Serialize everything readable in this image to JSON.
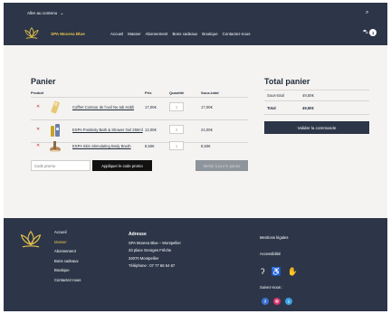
{
  "header": {
    "skip_link": "Aller au contenu",
    "brand": "SPA Moorea Blue",
    "nav": [
      "Accueil",
      "Masser",
      "Abonnement",
      "Bons cadeaux",
      "Boutique",
      "Contactez-nous"
    ],
    "cart_count": "1"
  },
  "cart": {
    "title": "Panier",
    "columns": [
      "Produit",
      "Prix",
      "Quantité",
      "Sous-total"
    ],
    "items": [
      {
        "name": "Coffret Contour de l'oeil Nu tab Hobli",
        "price": "17,00€",
        "qty": "1",
        "subtotal": "17,00€"
      },
      {
        "name": "ESPA Positivity Bath & Shower Gel 250ml",
        "price": "12,00€",
        "qty": "2",
        "subtotal": "24,00€"
      },
      {
        "name": "ESPA Skin Stimulating Body Brush",
        "price": "8,50€",
        "qty": "1",
        "subtotal": "8,50€"
      }
    ],
    "coupon_placeholder": "Code promo",
    "apply_coupon": "Appliquer le code promo",
    "update_cart": "Mettre à jour le panier"
  },
  "totals": {
    "title": "Total panier",
    "subtotal_label": "Sous-total",
    "subtotal_value": "49,50€",
    "total_label": "Total",
    "total_value": "49,50€",
    "checkout": "Valider la commande"
  },
  "footer": {
    "nav": [
      "Accueil",
      "Masser",
      "Abonnement",
      "Bons cadeaux",
      "Boutique",
      "Contactez-nous"
    ],
    "address_title": "Adresse",
    "address_lines": [
      "SPA Moorea Blue – Montpellier",
      "33 place Georges Frêche",
      "34070 Montpellier",
      "Téléphone : 07 77 66 54 67"
    ],
    "legal": "Mentions légales",
    "accessibility": "Accessibilité",
    "follow": "Suivez-nous :"
  },
  "colors": {
    "navy": "#2c3648",
    "gold": "#e6c04a",
    "page_bg": "#f4f3f1",
    "remove": "#c0392b"
  },
  "icons": [
    "search-icon",
    "cart-icon",
    "remove-icon",
    "accessibility-icon",
    "facebook-icon",
    "instagram-icon",
    "twitter-icon"
  ]
}
